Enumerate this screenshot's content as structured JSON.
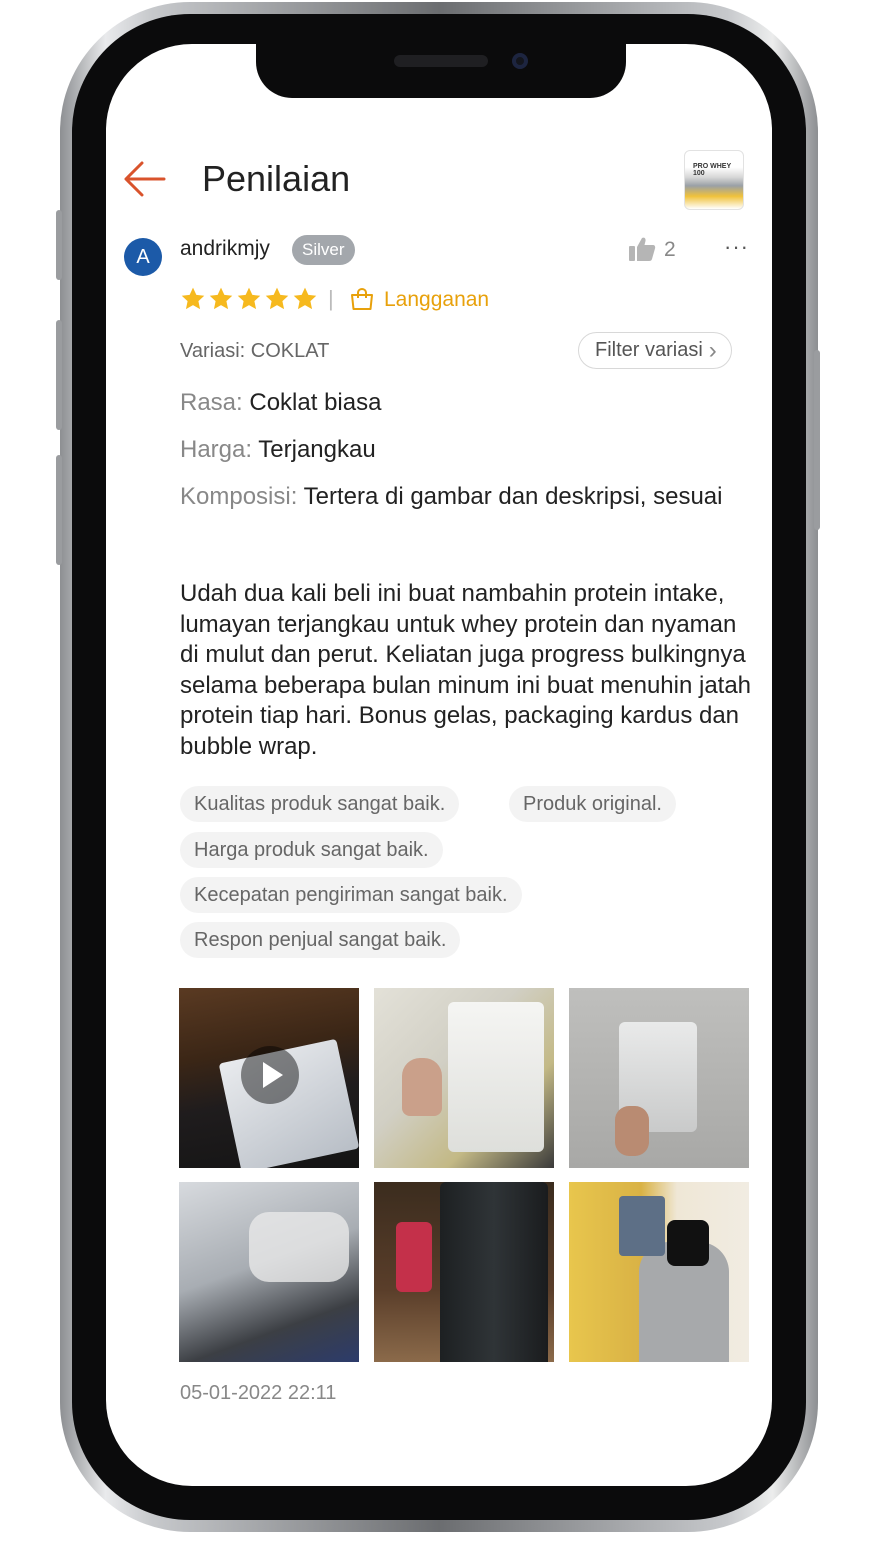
{
  "header": {
    "title": "Penilaian",
    "product_thumb_text": "PRO WHEY 100"
  },
  "review": {
    "avatar_initial": "A",
    "username": "andrikmjy",
    "badge": "Silver",
    "like_count": "2",
    "more_label": "···",
    "rating": 5,
    "separator": "|",
    "subscription_label": "Langganan",
    "variation": "Variasi: COKLAT",
    "filter_label": "Filter variasi",
    "filter_chevron": "›",
    "attributes": [
      {
        "key": "Rasa:",
        "value": " Coklat biasa"
      },
      {
        "key": "Harga:",
        "value": " Terjangkau"
      },
      {
        "key": "Komposisi:",
        "value": " Tertera di gambar dan deskripsi, sesuai"
      }
    ],
    "body": "Udah dua kali beli ini buat nambahin protein intake, lumayan terjangkau untuk whey protein dan nyaman di mulut dan perut. Keliatan juga progress bulkingnya selama beberapa bulan minum ini buat menuhin jatah protein tiap hari. Bonus gelas, packaging kardus dan bubble wrap.",
    "tags": [
      "Kualitas produk sangat baik.",
      "Produk original.",
      "Harga produk sangat baik.",
      "Kecepatan pengiriman sangat baik.",
      "Respon penjual sangat baik."
    ],
    "timestamp": "05-01-2022 22:11"
  },
  "colors": {
    "accent": "#ee4d2d",
    "star": "#f6b91e",
    "subscription": "#e8a10b",
    "avatar": "#1c5aa8",
    "badge": "#a3a7ac"
  }
}
